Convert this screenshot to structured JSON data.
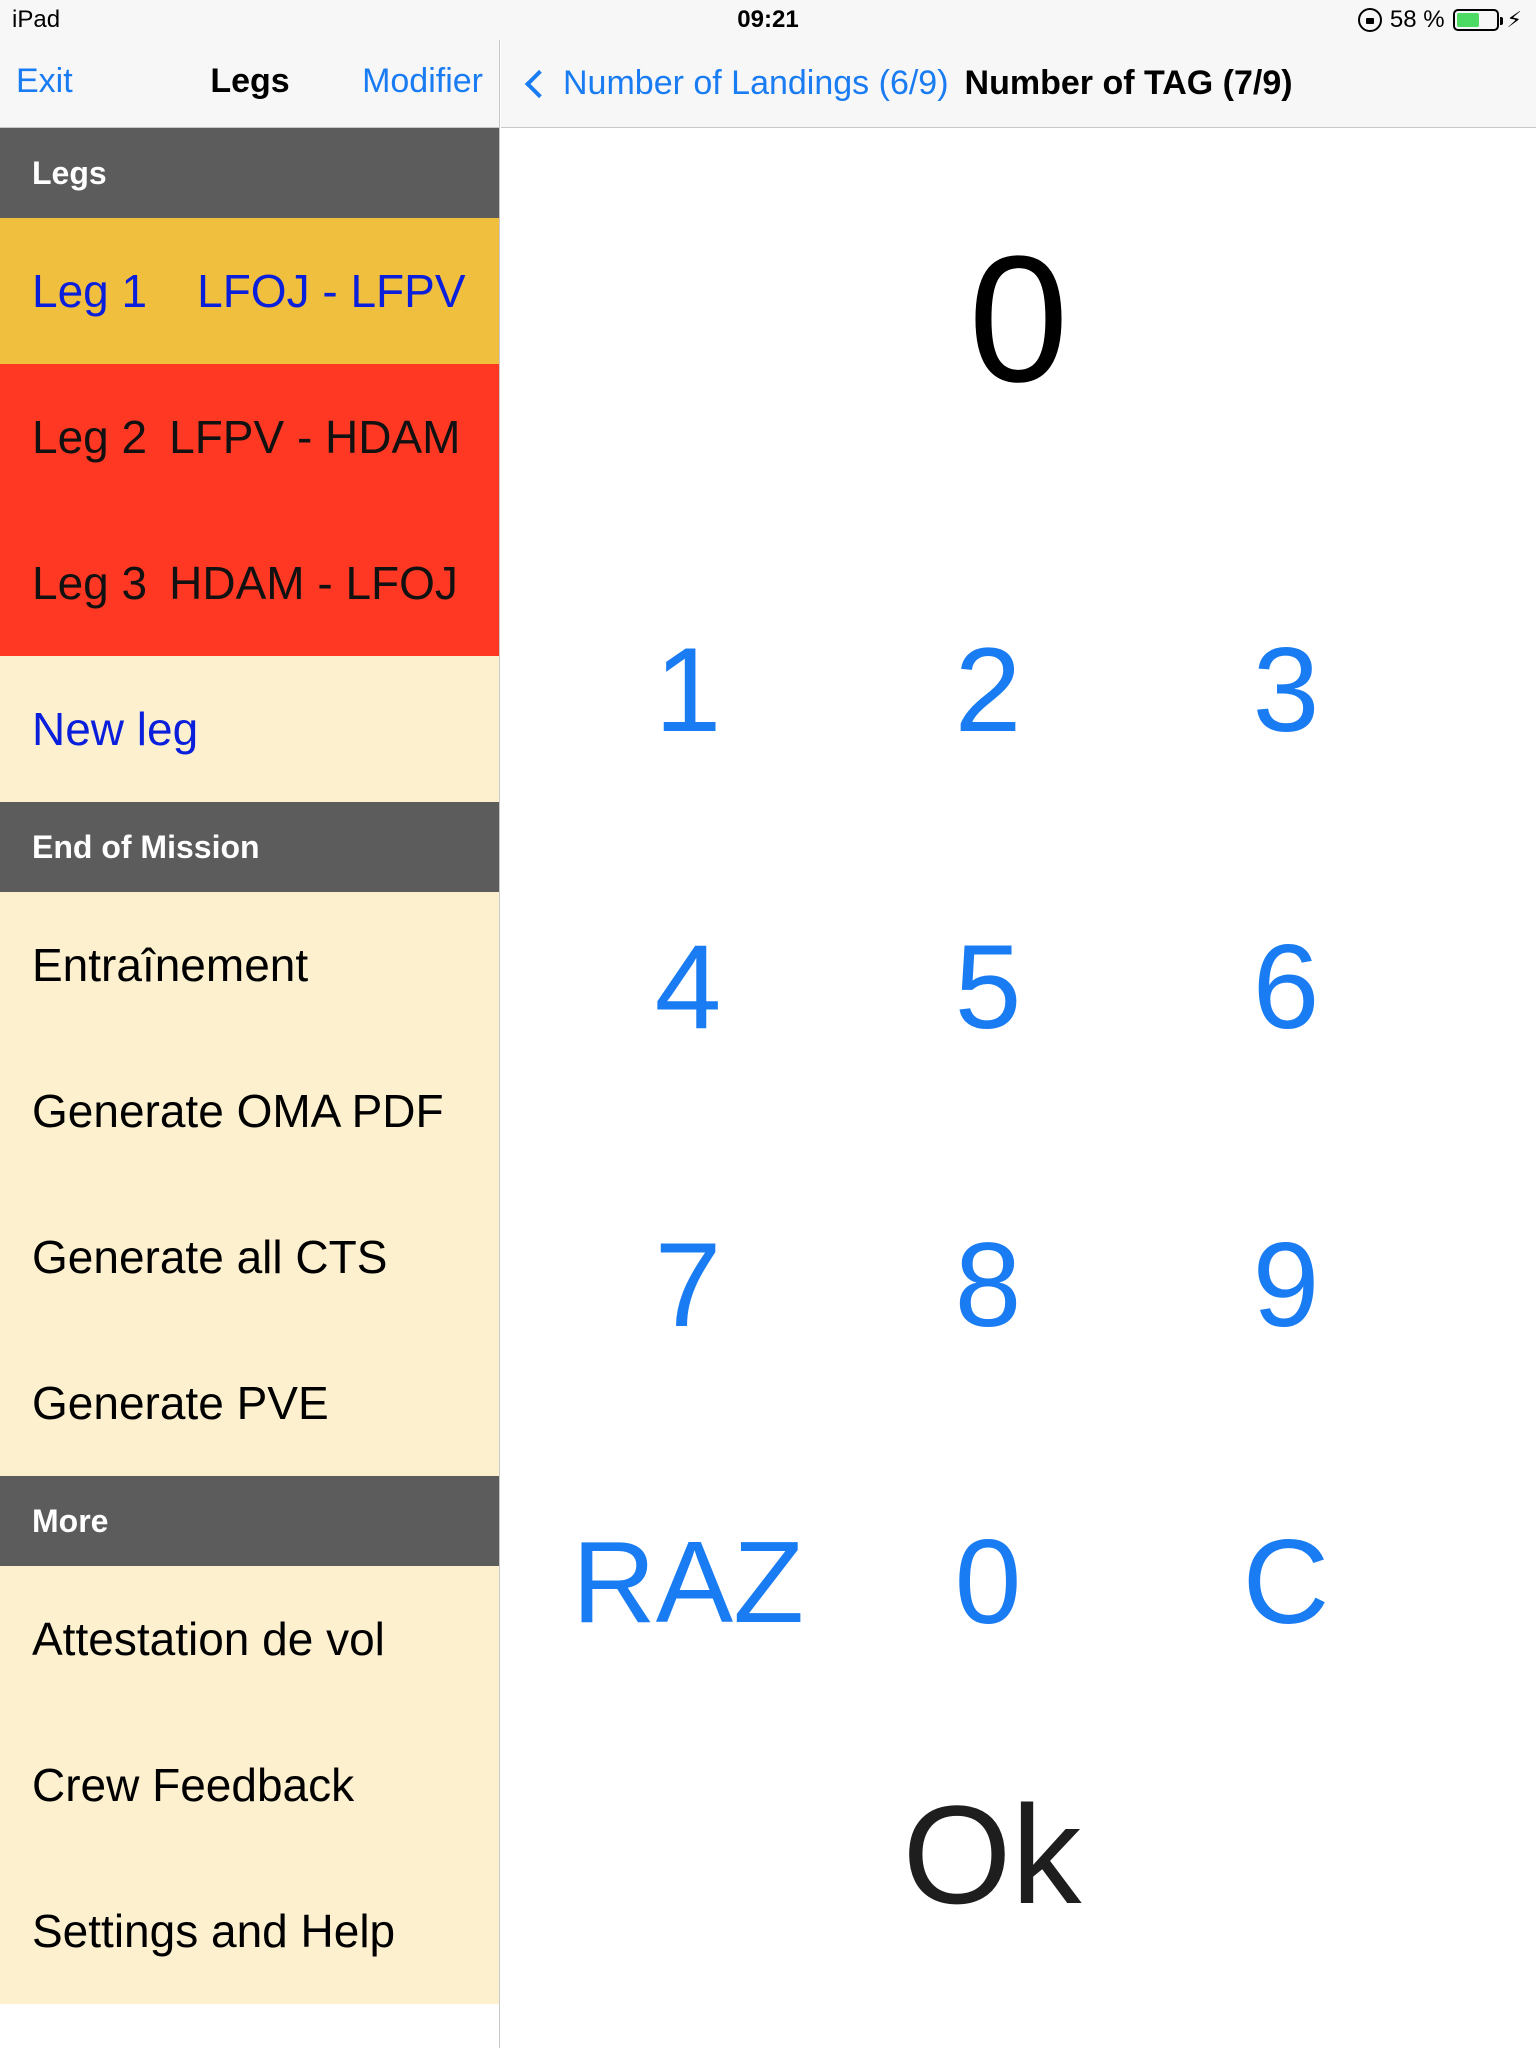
{
  "status_bar": {
    "device": "iPad",
    "time": "09:21",
    "battery": "58 %",
    "battery_level": 0.58,
    "icons": [
      "rotation-lock-icon",
      "battery-icon",
      "charging-bolt-icon"
    ]
  },
  "master": {
    "nav": {
      "left": "Exit",
      "title": "Legs",
      "right": "Modifier"
    },
    "sections": {
      "legs": "Legs",
      "end_of_mission": "End of Mission",
      "more": "More"
    },
    "legs": [
      {
        "num": "Leg 1",
        "route": "LFOJ - LFPV",
        "status_color": "#f0bf3e"
      },
      {
        "num": "Leg 2",
        "route": "LFPV - HDAM",
        "status_color": "#ff3824"
      },
      {
        "num": "Leg 3",
        "route": "HDAM - LFOJ",
        "status_color": "#ff3824"
      }
    ],
    "new_leg": "New leg",
    "end_of_mission_items": [
      "Entraînement",
      "Generate OMA PDF",
      "Generate all CTS",
      "Generate PVE"
    ],
    "more_items": [
      "Attestation de vol",
      "Crew Feedback",
      "Settings and Help"
    ]
  },
  "detail": {
    "nav": {
      "back": "Number of Landings (6/9)",
      "title": "Number of TAG (7/9)"
    },
    "display": "0",
    "keys": [
      "1",
      "2",
      "3",
      "4",
      "5",
      "6",
      "7",
      "8",
      "9",
      "RAZ",
      "0",
      "C"
    ],
    "ok": "Ok"
  },
  "colors": {
    "accent": "#1a7cf2",
    "section_header": "#5c5c5c",
    "row_background": "#fdf0cf",
    "leg_link": "#0a1fdb"
  }
}
